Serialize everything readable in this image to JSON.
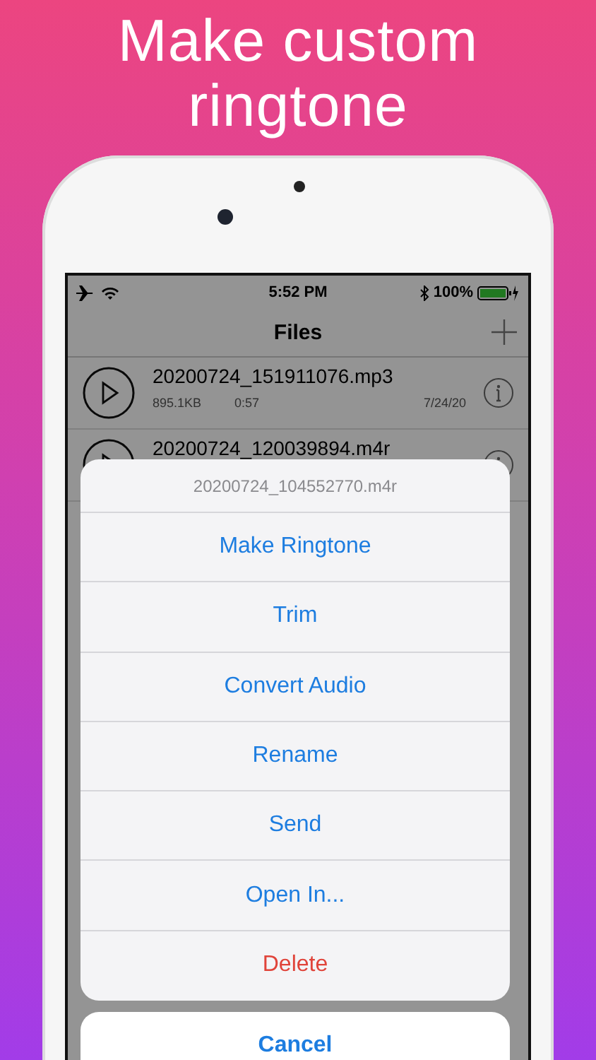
{
  "headline": "Make custom ringtone",
  "status_bar": {
    "time": "5:52 PM",
    "battery": "100%"
  },
  "nav": {
    "title": "Files"
  },
  "files": [
    {
      "name": "20200724_151911076.mp3",
      "size": "895.1KB",
      "duration": "0:57",
      "date": "7/24/20"
    },
    {
      "name": "20200724_120039894.m4r"
    }
  ],
  "action_sheet": {
    "title": "20200724_104552770.m4r",
    "actions": [
      {
        "label": "Make Ringtone",
        "kind": "default"
      },
      {
        "label": "Trim",
        "kind": "default"
      },
      {
        "label": "Convert Audio",
        "kind": "default"
      },
      {
        "label": "Rename",
        "kind": "default"
      },
      {
        "label": "Send",
        "kind": "default"
      },
      {
        "label": "Open In...",
        "kind": "default"
      },
      {
        "label": "Delete",
        "kind": "destructive"
      }
    ],
    "cancel": "Cancel"
  }
}
